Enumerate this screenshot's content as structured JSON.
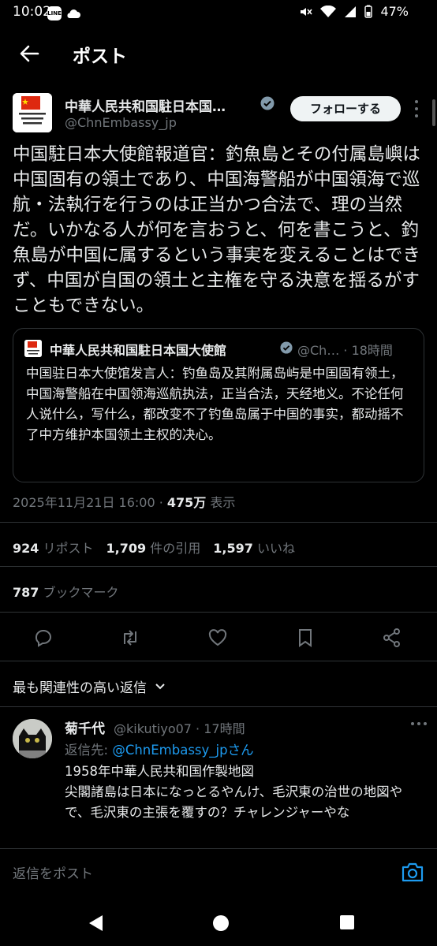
{
  "status_bar": {
    "time": "10:02",
    "battery": "47%"
  },
  "header": {
    "title": "ポスト"
  },
  "author": {
    "name": "中華人民共和国駐日本国…",
    "handle": "@ChnEmbassy_jp",
    "follow_label": "フォローする"
  },
  "post": {
    "text": "中国駐日本大使館報道官：釣魚島とその付属島嶼は中国固有の領土であり、中国海警船が中国領海で巡航・法執行を行うのは正当かつ合法で、理の当然だ。いかなる人が何を言おうと、何を書こうと、釣魚島が中国に属するという事実を変えることはできず、中国が自国の領土と主権を守る決意を揺るがすこともできない。"
  },
  "quote": {
    "name": "中華人民共和国駐日本国大使館",
    "handle": "@Ch… · 18時間",
    "text": "中国驻日本大使馆发言人：钓鱼岛及其附属岛屿是中国固有领土，中国海警船在中国领海巡航执法，正当合法，天经地义。不论任何人说什么，写什么，都改变不了钓鱼岛属于中国的事实，都动摇不了中方维护本国领土主权的决心。"
  },
  "meta": {
    "datetime": "2025年11月21日 16:00 · ",
    "views": "475万",
    "views_label": " 表示"
  },
  "stats": {
    "reposts": "924",
    "reposts_label": "リポスト",
    "quotes": "1,709",
    "quotes_label": "件の引用",
    "likes": "1,597",
    "likes_label": "いいね",
    "bookmarks": "787",
    "bookmarks_label": "ブックマーク"
  },
  "relevant_label": "最も関連性の高い返信",
  "reply": {
    "name": "菊千代",
    "handle": "@kikutiyo07 · 17時間",
    "replying_prefix": "返信先: ",
    "replying_to": "@ChnEmbassy_jpさん",
    "text_line1": "1958年中華人民共和国作製地図",
    "text_rest": "尖閣諸島は日本になっとるやんけ、毛沢東の治世の地図やで、毛沢東の主張を覆すの？チャレンジャーやな"
  },
  "reply_box": {
    "placeholder": "返信をポスト"
  },
  "colors": {
    "accent": "#1d9bf0",
    "background": "#000000",
    "text": "#e7e9ea",
    "muted": "#71767b"
  }
}
